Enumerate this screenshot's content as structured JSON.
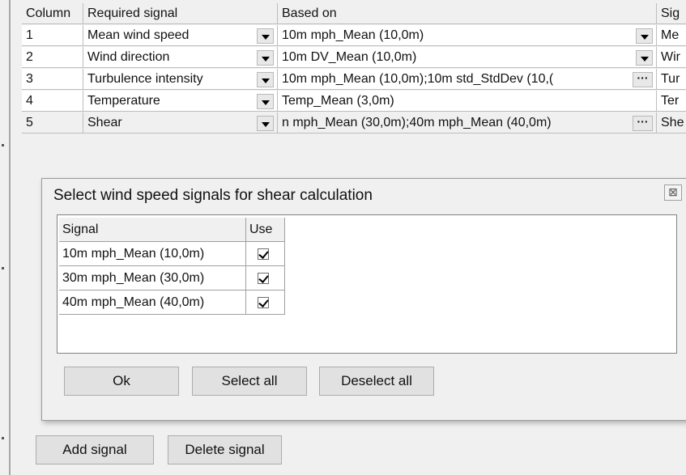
{
  "grid": {
    "headers": [
      "Column",
      "Required signal",
      "Based on",
      "Sig"
    ],
    "rows": [
      {
        "column": "1",
        "required": "Mean wind speed",
        "based_on": "10m mph_Mean (10,0m)",
        "sig": "Me"
      },
      {
        "column": "2",
        "required": "Wind direction",
        "based_on": "10m DV_Mean (10,0m)",
        "sig": "Wir"
      },
      {
        "column": "3",
        "required": "Turbulence intensity",
        "based_on": "10m mph_Mean (10,0m);10m std_StdDev (10,(",
        "sig": "Tur"
      },
      {
        "column": "4",
        "required": "Temperature",
        "based_on": "Temp_Mean (3,0m)",
        "sig": "Ter"
      },
      {
        "column": "5",
        "required": "Shear",
        "based_on": "n mph_Mean (30,0m);40m mph_Mean (40,0m)",
        "sig": "She"
      }
    ],
    "ellipsis_label": "···"
  },
  "dialog": {
    "title": "Select wind speed signals for shear calculation",
    "close_glyph": "⊠",
    "table": {
      "headers": [
        "Signal",
        "Use"
      ],
      "rows": [
        {
          "signal": "10m mph_Mean (10,0m)",
          "use": true
        },
        {
          "signal": "30m mph_Mean (30,0m)",
          "use": true
        },
        {
          "signal": "40m mph_Mean (40,0m)",
          "use": true
        }
      ]
    },
    "buttons": {
      "ok": "Ok",
      "select_all": "Select all",
      "deselect_all": "Deselect all"
    }
  },
  "footer": {
    "add_signal": "Add signal",
    "delete_signal": "Delete signal"
  }
}
